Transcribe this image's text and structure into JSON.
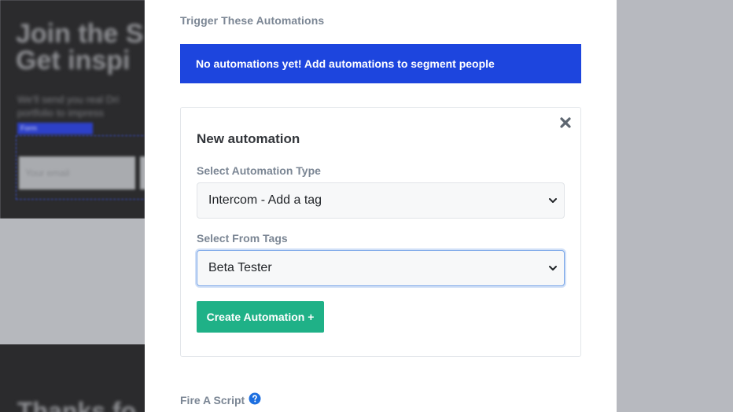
{
  "background": {
    "headline": "Join the S\nGet inspi",
    "subtext": "We'll send you real Dri portfolio to impress",
    "toolbar_text": "Form",
    "email_placeholder": "Your email",
    "thanks_text": "Thanks fo"
  },
  "automations": {
    "section_label": "Trigger These Automations",
    "empty_message": "No automations yet! Add automations to segment people"
  },
  "new_automation": {
    "title": "New automation",
    "type_label": "Select Automation Type",
    "type_value": "Intercom - Add a tag",
    "tags_label": "Select From Tags",
    "tags_value": "Beta Tester",
    "create_label": "Create Automation +",
    "close_icon": "close-icon"
  },
  "script": {
    "label": "Fire A Script",
    "help_icon": "question-circle-icon"
  },
  "colors": {
    "alert_bg": "#1d45de",
    "button_bg": "#1fb187",
    "help_icon": "#1d6fe0"
  }
}
